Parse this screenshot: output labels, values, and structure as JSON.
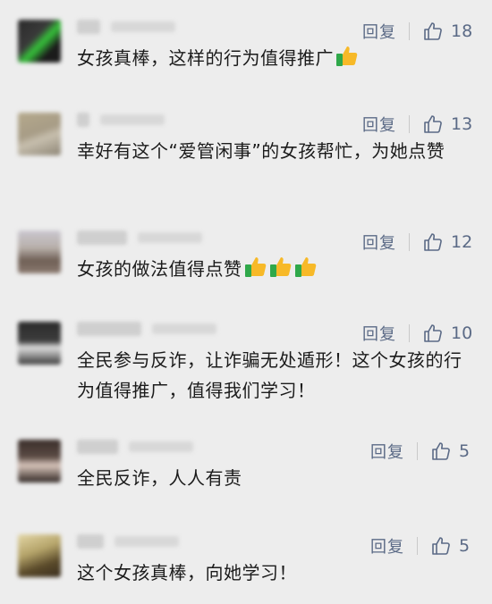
{
  "comments": [
    {
      "text": "女孩真棒，这样的行为值得推广",
      "emoji_after": 1,
      "reply_label": "回复",
      "likes": "18"
    },
    {
      "text": "幸好有这个“爱管闲事”的女孩帮忙，为她点赞",
      "emoji_after": 0,
      "reply_label": "回复",
      "likes": "13"
    },
    {
      "text": "女孩的做法值得点赞",
      "emoji_after": 3,
      "reply_label": "回复",
      "likes": "12"
    },
    {
      "text": "全民参与反诈，让诈骗无处遁形！这个女孩的行为值得推广，值得我们学习！",
      "emoji_after": 0,
      "reply_label": "回复",
      "likes": "10"
    },
    {
      "text": "全民反诈，人人有责",
      "emoji_after": 0,
      "reply_label": "回复",
      "likes": "5"
    },
    {
      "text": "这个女孩真棒，向她学习！",
      "emoji_after": 0,
      "reply_label": "回复",
      "likes": "5"
    }
  ],
  "icons": {
    "like": "thumbs-up-outline-icon",
    "emoji": "thumbs-up-emoji"
  },
  "colors": {
    "background": "#ededed",
    "text": "#1b1b1b",
    "action": "#5b6a86"
  }
}
